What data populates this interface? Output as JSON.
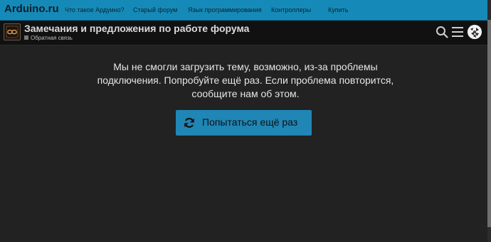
{
  "topbar": {
    "brand": "Arduino.ru",
    "nav": [
      {
        "label": "Что такое Ардуино?"
      },
      {
        "label": "Старый форум"
      },
      {
        "label": "Язык программирования"
      },
      {
        "label": "Контроллеры"
      },
      {
        "label": "Купить"
      }
    ]
  },
  "header": {
    "title": "Замечания и предложения по работе форума",
    "category": "Обратная связь",
    "icons": [
      "search-icon",
      "menu-icon",
      "avatar"
    ]
  },
  "main": {
    "message": "Мы не смогли загрузить тему, возможно, из-за проблемы подключения. Попробуйте ещё раз. Если проблема повторится, сообщите нам об этом.",
    "retry_label": "Попытаться ещё раз",
    "retry_icon": "refresh-icon"
  },
  "colors": {
    "topbar": "#158ab8",
    "background": "#222222",
    "header": "#111111",
    "button": "#1f86b5"
  }
}
